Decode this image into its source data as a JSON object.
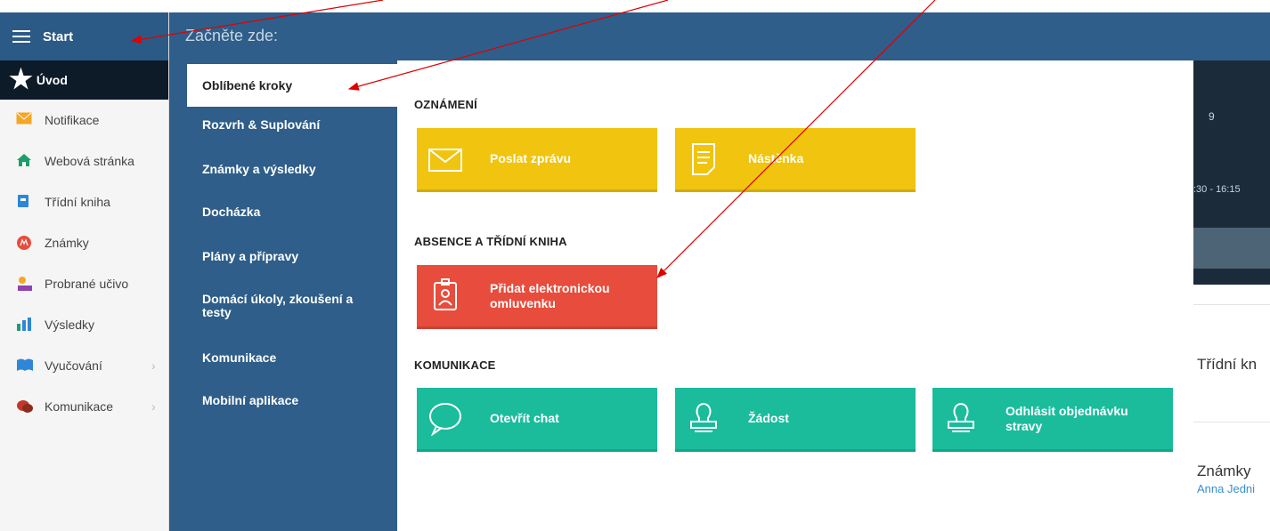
{
  "sidebar": {
    "start_label": "Start",
    "active_label": "Úvod",
    "items": [
      {
        "label": "Notifikace",
        "icon": "envelope-icon",
        "color": "#f5a623"
      },
      {
        "label": "Webová stránka",
        "icon": "home-icon",
        "color": "#1e9e6b"
      },
      {
        "label": "Třídní kniha",
        "icon": "book-icon",
        "color": "#2f86d6"
      },
      {
        "label": "Známky",
        "icon": "grade-icon",
        "color": "#e74c3c"
      },
      {
        "label": "Probrané učivo",
        "icon": "teacher-icon",
        "color": "#8e44ad"
      },
      {
        "label": "Výsledky",
        "icon": "barchart-icon",
        "color": "#2f86d6"
      },
      {
        "label": "Vyučování",
        "icon": "openbook-icon",
        "color": "#2f86d6",
        "submenu": "›"
      },
      {
        "label": "Komunikace",
        "icon": "chat-icon",
        "color": "#c0392b",
        "submenu": "›"
      }
    ]
  },
  "header": {
    "title": "Začněte zde:"
  },
  "menu": {
    "active": "Oblíbené kroky",
    "items": [
      "Rozvrh & Suplování",
      "Známky a výsledky",
      "Docházka",
      "Plány a přípravy",
      "Domácí úkoly, zkoušení a testy",
      "Komunikace",
      "Mobilní aplikace"
    ]
  },
  "content": {
    "sections": [
      {
        "title": "OZNÁMENÍ",
        "tiles": [
          {
            "label": "Poslat zprávu",
            "icon": "envelope-icon",
            "color": "#f0c40f"
          },
          {
            "label": "Nástěnka",
            "icon": "board-icon",
            "color": "#f0c40f"
          }
        ]
      },
      {
        "title": "ABSENCE A TŘÍDNÍ KNIHA",
        "tiles": [
          {
            "label": "Přidat elektronickou omluvenku",
            "icon": "badge-icon",
            "color": "#e74c3c"
          }
        ]
      },
      {
        "title": "KOMUNIKACE",
        "tiles": [
          {
            "label": "Otevřít chat",
            "icon": "chat-bubble-icon",
            "color": "#1abc9c"
          },
          {
            "label": "Žádost",
            "icon": "stamp-icon",
            "color": "#1abc9c"
          },
          {
            "label": "Odhlásit objednávku stravy",
            "icon": "stamp-icon",
            "color": "#1abc9c"
          }
        ]
      }
    ]
  },
  "background": {
    "number": "9",
    "time": ":30 - 16:15",
    "text1": "Třídní kn",
    "text2": "Známky",
    "text3": "Anna Jedni"
  },
  "colors": {
    "header": "#2e5e89",
    "annotation_arrow": "#e00000"
  }
}
